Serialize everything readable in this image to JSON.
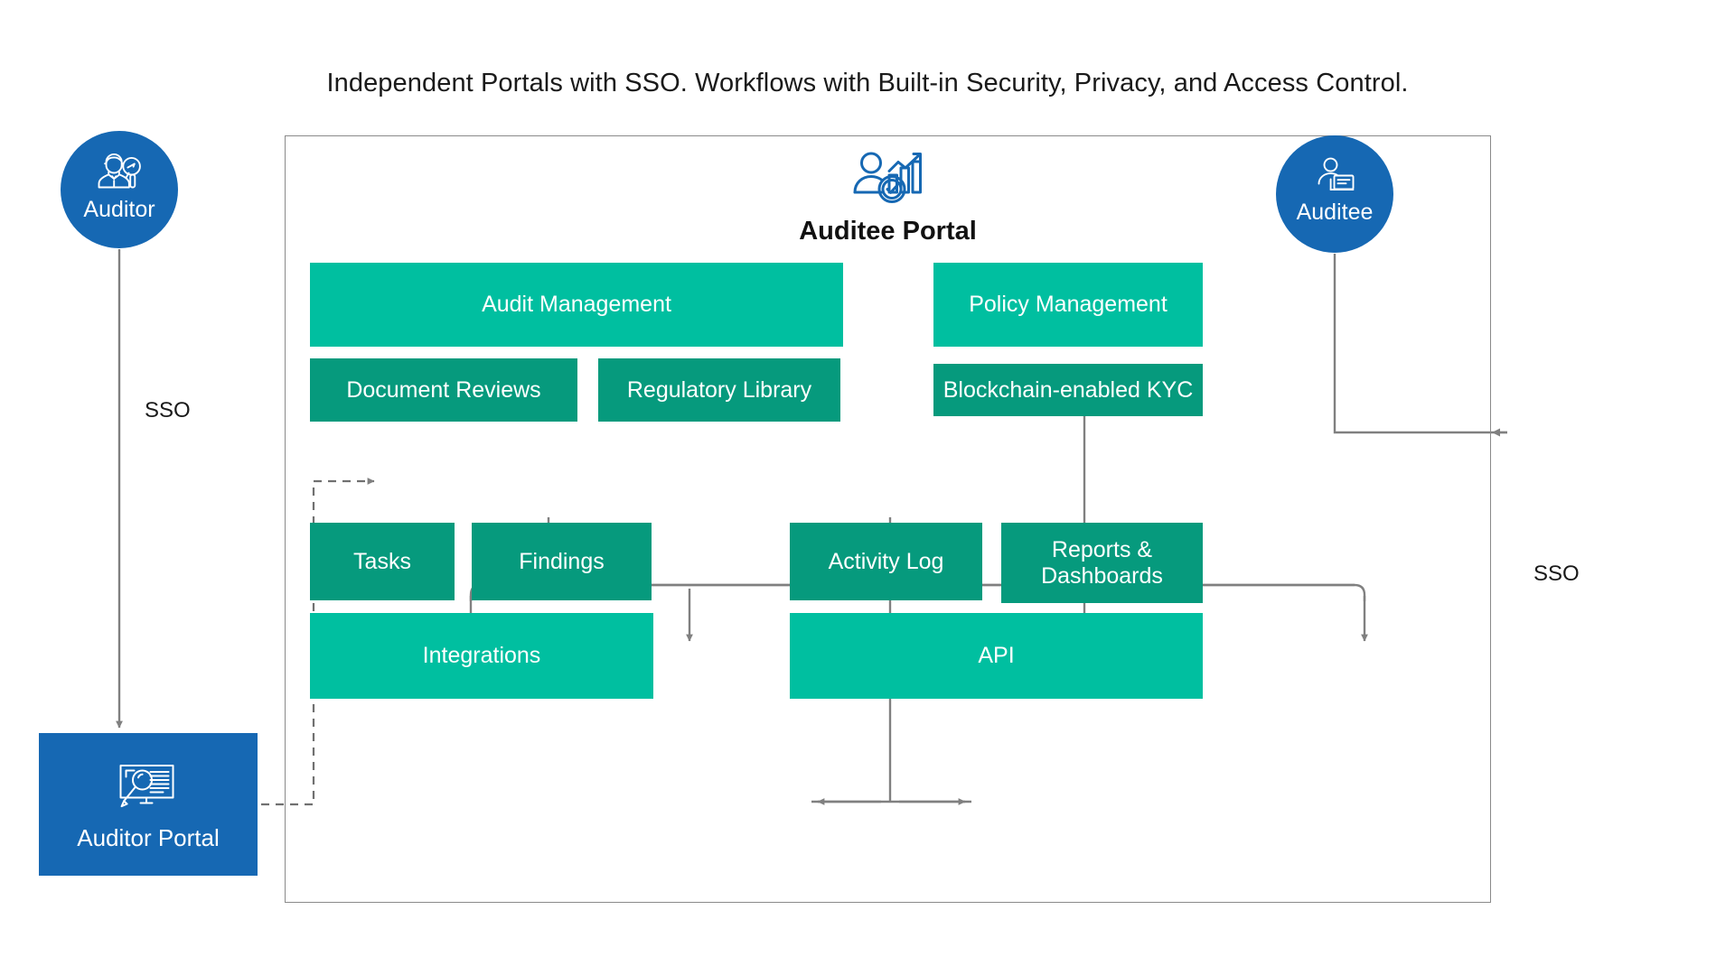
{
  "title": "Independent Portals with SSO. Workflows with Built-in Security, Privacy, and Access Control.",
  "actors": {
    "auditor": {
      "label": "Auditor",
      "icon": "auditor-magnifier-icon",
      "color": "#1668B3"
    },
    "auditee": {
      "label": "Auditee",
      "icon": "auditee-person-screen-icon",
      "color": "#1668B3"
    }
  },
  "portals": {
    "auditor_portal": {
      "label": "Auditor Portal",
      "icon": "monitor-magnifier-icon",
      "color": "#1668B3"
    },
    "auditee_portal": {
      "label": "Auditee Portal",
      "icon": "person-barchart-check-icon",
      "color": "#1668B3"
    }
  },
  "edges": {
    "sso_left": "SSO",
    "sso_right": "SSO"
  },
  "colors": {
    "accent_blue": "#1668B3",
    "teal_light": "#00bfa0",
    "teal_dark": "#069a7d",
    "connector_gray": "#808080",
    "frame_gray": "#8a8a8a"
  },
  "modules": [
    {
      "id": "audit-management",
      "label": "Audit Management",
      "tone": "light"
    },
    {
      "id": "policy-management",
      "label": "Policy Management",
      "tone": "light"
    },
    {
      "id": "document-reviews",
      "label": "Document Reviews",
      "tone": "dark"
    },
    {
      "id": "regulatory-library",
      "label": "Regulatory Library",
      "tone": "dark"
    },
    {
      "id": "blockchain-kyc",
      "label": "Blockchain-enabled KYC",
      "tone": "dark"
    },
    {
      "id": "tasks",
      "label": "Tasks",
      "tone": "dark"
    },
    {
      "id": "findings",
      "label": "Findings",
      "tone": "dark"
    },
    {
      "id": "activity-log",
      "label": "Activity Log",
      "tone": "dark"
    },
    {
      "id": "reports-dashboards",
      "label": "Reports &\nDashboards",
      "tone": "dark"
    },
    {
      "id": "integrations",
      "label": "Integrations",
      "tone": "light"
    },
    {
      "id": "api",
      "label": "API",
      "tone": "light"
    }
  ]
}
